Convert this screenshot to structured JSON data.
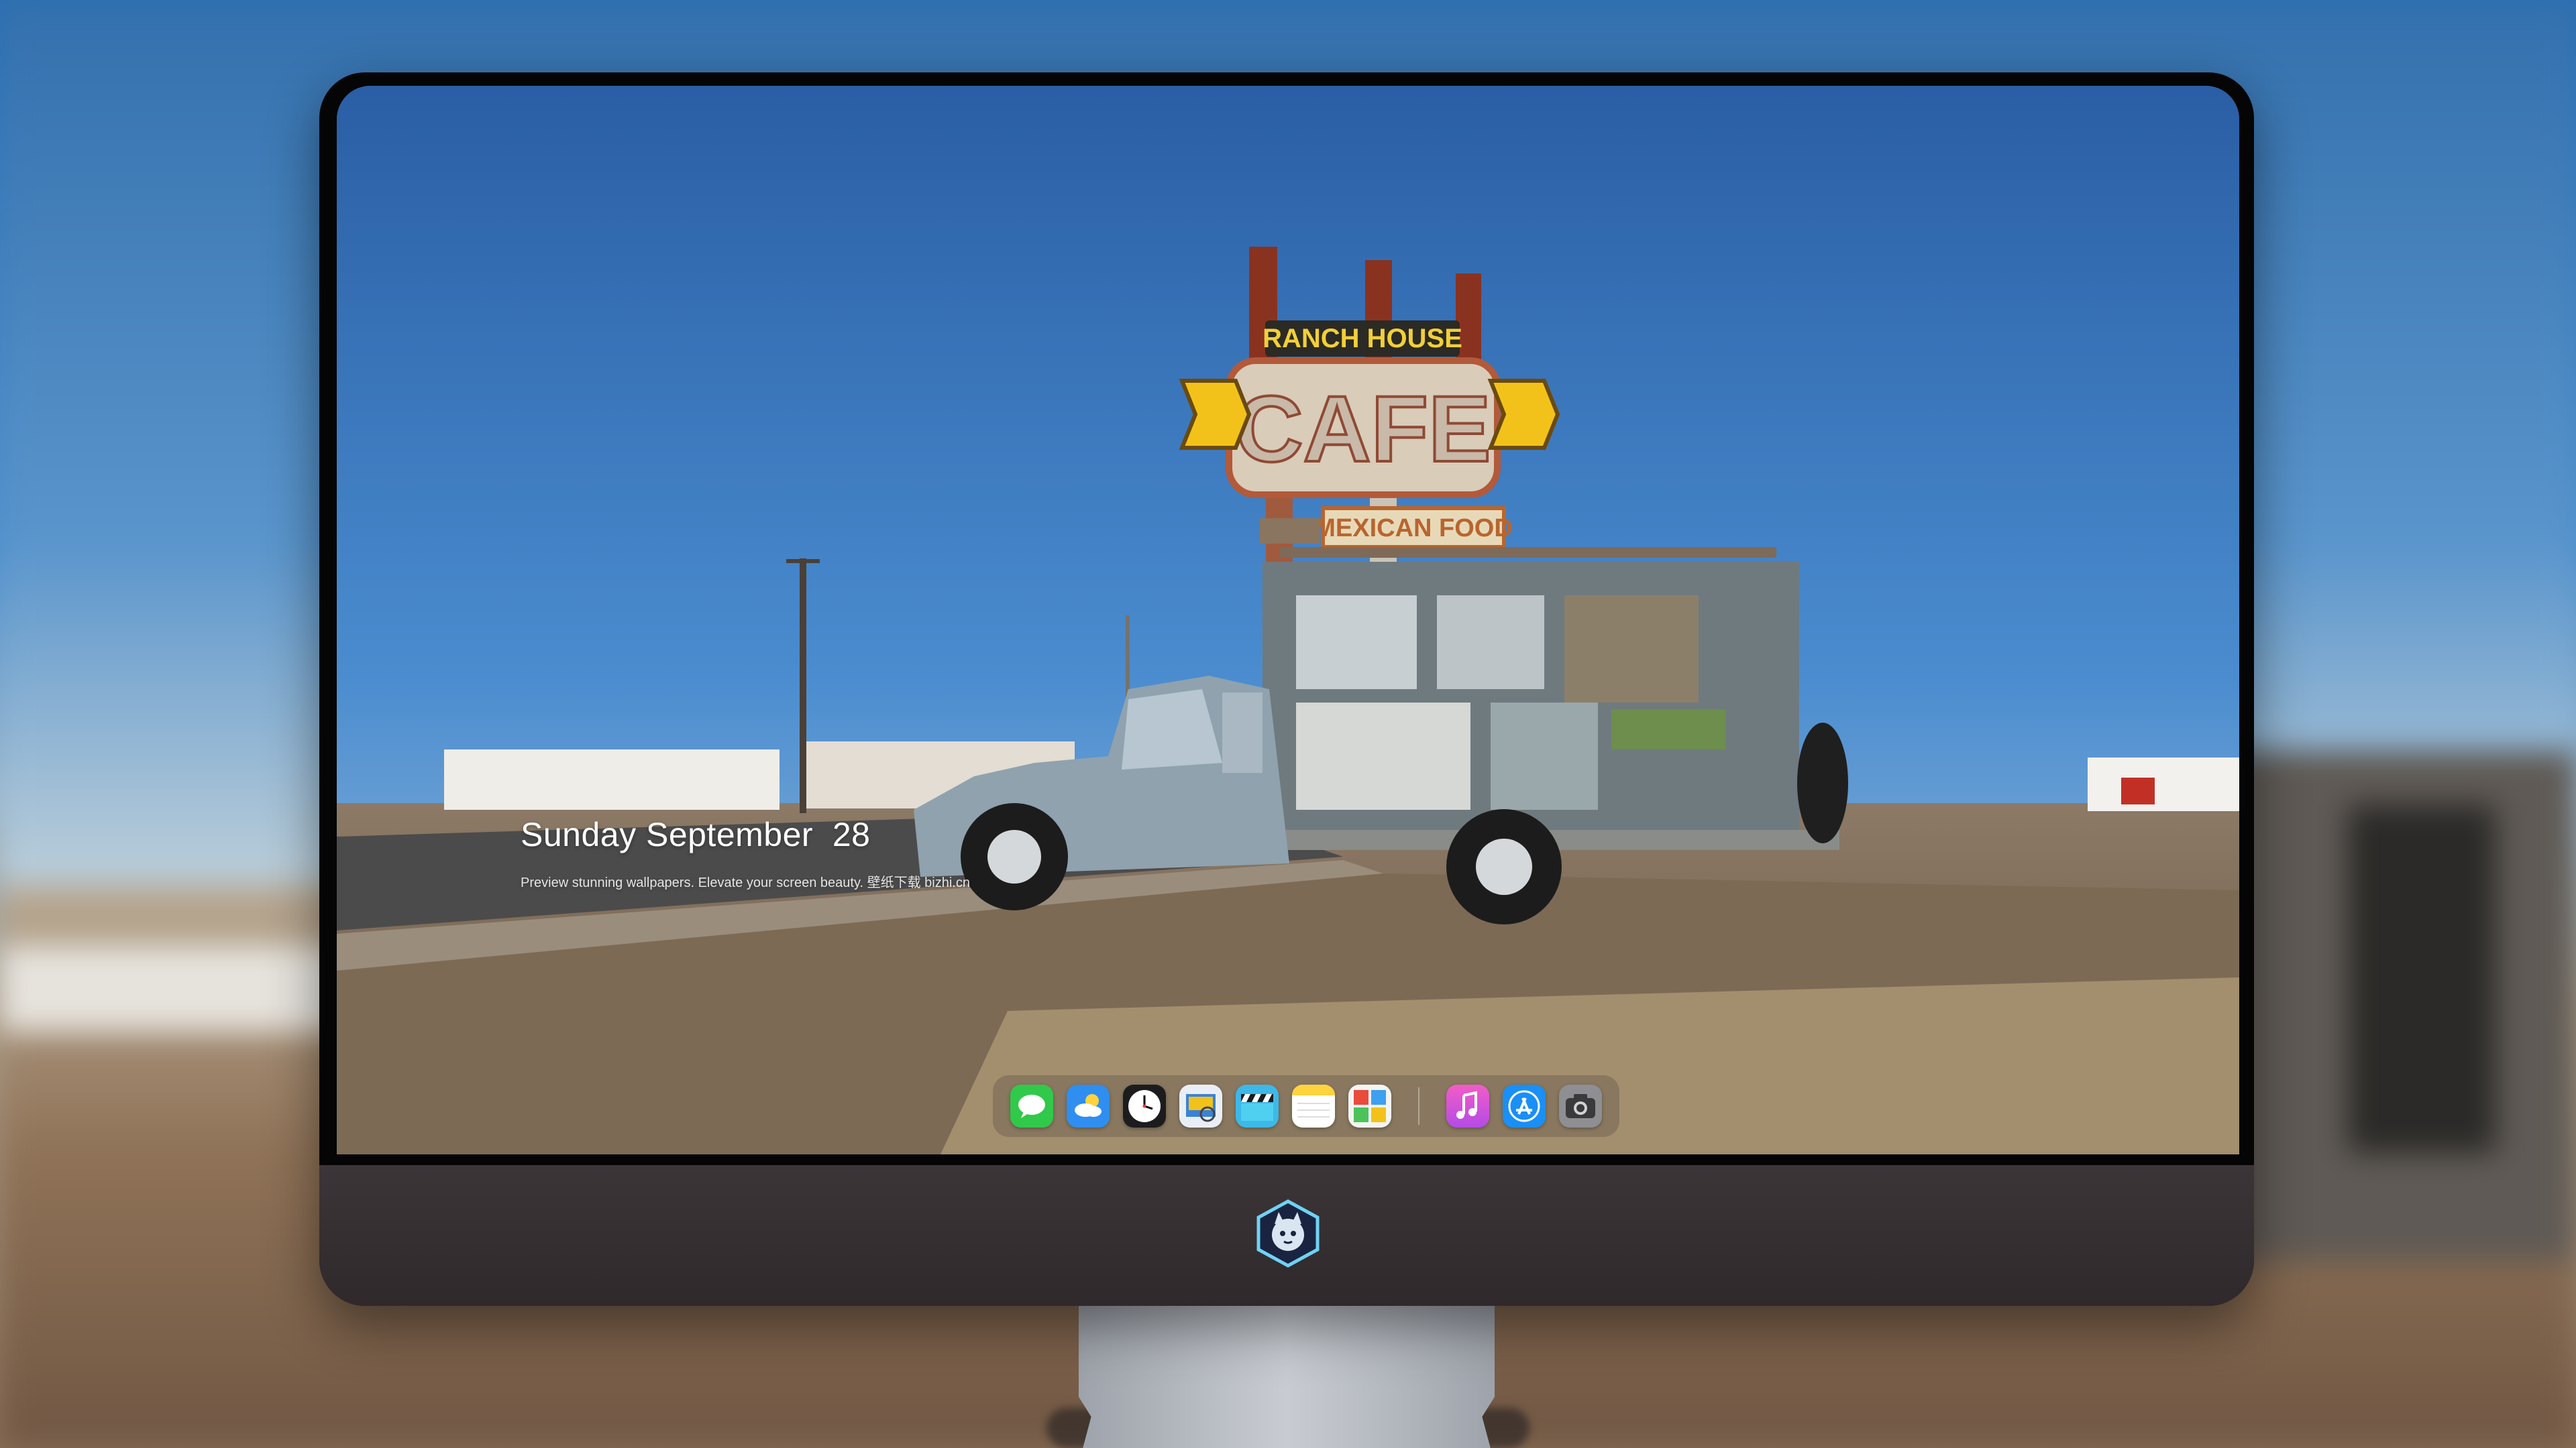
{
  "lockscreen": {
    "date": "Sunday September  28",
    "caption": "Preview stunning wallpapers. Elevate your screen beauty. 壁纸下载 bizhi.cn"
  },
  "wallpaper_signs": {
    "top": "RANCH HOUSE",
    "main": "CAFE",
    "bottom": "MEXICAN FOOD"
  },
  "dock": {
    "apps": [
      {
        "name": "Messages",
        "icon": "messages-icon",
        "color": "#31c94a"
      },
      {
        "name": "Weather",
        "icon": "weather-icon",
        "color": "#2f8ef0"
      },
      {
        "name": "Clock",
        "icon": "clock-icon",
        "color": "#1c1c1e"
      },
      {
        "name": "Preview",
        "icon": "preview-icon",
        "color": "#e9eef6"
      },
      {
        "name": "Clips",
        "icon": "clips-icon",
        "color": "#3db8e8"
      },
      {
        "name": "Notes",
        "icon": "notes-icon",
        "color": "#ffd33d"
      },
      {
        "name": "Photo Booth",
        "icon": "photobooth-icon",
        "color": "#f4f4f4"
      },
      {
        "name": "iTunes",
        "icon": "music-icon",
        "color": "#e84bd6"
      },
      {
        "name": "App Store",
        "icon": "app-store-icon",
        "color": "#1a8ff5"
      },
      {
        "name": "Camera",
        "icon": "camera-icon",
        "color": "#8e8e93"
      }
    ]
  },
  "colors": {
    "sky": "#3f80c6",
    "bezel": "#050506",
    "chin": "#35302f",
    "stand": "#b8bcc3"
  }
}
